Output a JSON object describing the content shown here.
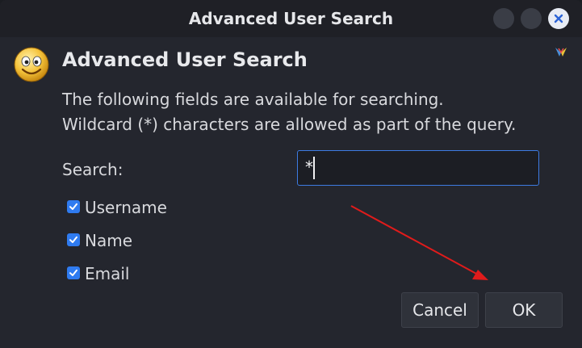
{
  "window": {
    "title": "Advanced User Search",
    "controls": [
      "minimize",
      "maximize",
      "close"
    ]
  },
  "header": {
    "icon": "smiley-face-icon",
    "title": "Advanced User Search",
    "help_icon": "help-icon"
  },
  "description": {
    "line1": "The following fields are available for searching.",
    "line2": "Wildcard (*) characters are allowed as part of the query."
  },
  "search": {
    "label": "Search:",
    "value": "*"
  },
  "fields": [
    {
      "label": "Username",
      "checked": true
    },
    {
      "label": "Name",
      "checked": true
    },
    {
      "label": "Email",
      "checked": true
    }
  ],
  "buttons": {
    "cancel": "Cancel",
    "ok": "OK"
  },
  "colors": {
    "accent": "#2f7bf0",
    "annotation_arrow": "#e01b1b"
  }
}
